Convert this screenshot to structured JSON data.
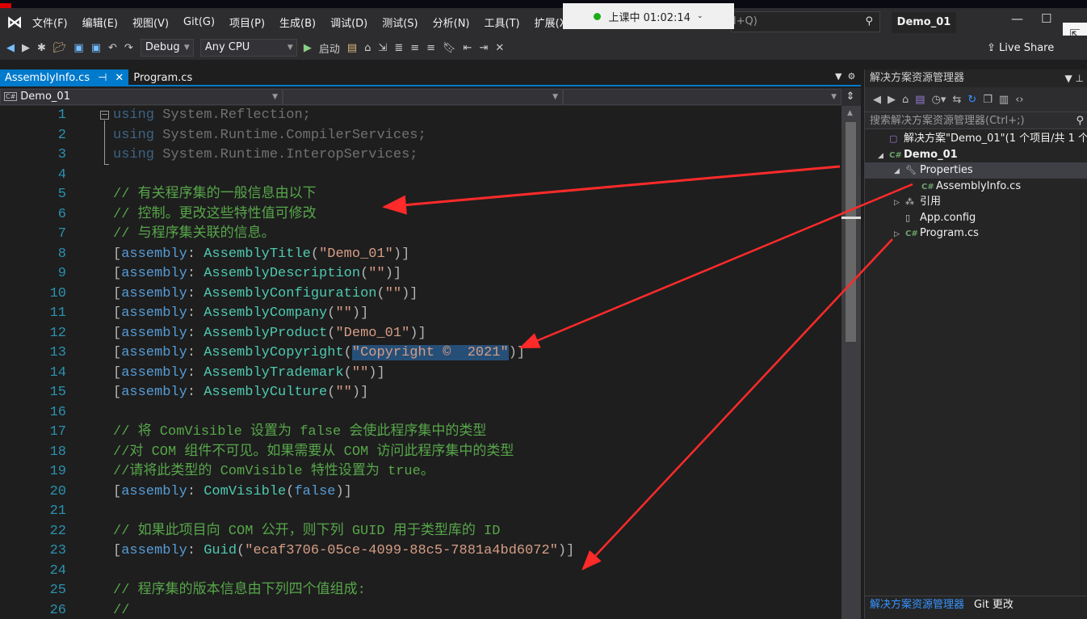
{
  "menu": {
    "items": [
      "文件(F)",
      "编辑(E)",
      "视图(V)",
      "Git(G)",
      "项目(P)",
      "生成(B)",
      "调试(D)",
      "测试(S)",
      "分析(N)",
      "工具(T)",
      "扩展(X)"
    ]
  },
  "recording": {
    "label": "上课中 01:02:14",
    "status_color": "#1aad19"
  },
  "search": {
    "placeholder": "l+Q)"
  },
  "title": "Demo_01",
  "toolbar": {
    "config": "Debug",
    "platform": "Any CPU",
    "start": "启动",
    "live_share": "Live Share"
  },
  "tabs": [
    {
      "label": "AssemblyInfo.cs",
      "active": true
    },
    {
      "label": "Program.cs",
      "active": false
    }
  ],
  "navbar": {
    "project": "Demo_01"
  },
  "code": {
    "lines": [
      [
        [
          "k d",
          "using"
        ],
        [
          "p d",
          " System.Reflection;"
        ]
      ],
      [
        [
          "k d",
          "using"
        ],
        [
          "p d",
          " System.Runtime.CompilerServices;"
        ]
      ],
      [
        [
          "k d",
          "using"
        ],
        [
          "p d",
          " System.Runtime.InteropServices;"
        ]
      ],
      [],
      [
        [
          "c",
          "// 有关程序集的一般信息由以下"
        ]
      ],
      [
        [
          "c",
          "// 控制。更改这些特性值可修改"
        ]
      ],
      [
        [
          "c",
          "// 与程序集关联的信息。"
        ]
      ],
      [
        [
          "p",
          "["
        ],
        [
          "k",
          "assembly"
        ],
        [
          "p",
          ": "
        ],
        [
          "t",
          "AssemblyTitle"
        ],
        [
          "p",
          "("
        ],
        [
          "s",
          "\"Demo_01\""
        ],
        [
          "p",
          ")]"
        ]
      ],
      [
        [
          "p",
          "["
        ],
        [
          "k",
          "assembly"
        ],
        [
          "p",
          ": "
        ],
        [
          "t",
          "AssemblyDescription"
        ],
        [
          "p",
          "("
        ],
        [
          "s",
          "\"\""
        ],
        [
          "p",
          ")]"
        ]
      ],
      [
        [
          "p",
          "["
        ],
        [
          "k",
          "assembly"
        ],
        [
          "p",
          ": "
        ],
        [
          "t",
          "AssemblyConfiguration"
        ],
        [
          "p",
          "("
        ],
        [
          "s",
          "\"\""
        ],
        [
          "p",
          ")]"
        ]
      ],
      [
        [
          "p",
          "["
        ],
        [
          "k",
          "assembly"
        ],
        [
          "p",
          ": "
        ],
        [
          "t",
          "AssemblyCompany"
        ],
        [
          "p",
          "("
        ],
        [
          "s",
          "\"\""
        ],
        [
          "p",
          ")]"
        ]
      ],
      [
        [
          "p",
          "["
        ],
        [
          "k",
          "assembly"
        ],
        [
          "p",
          ": "
        ],
        [
          "t",
          "AssemblyProduct"
        ],
        [
          "p",
          "("
        ],
        [
          "s",
          "\"Demo_01\""
        ],
        [
          "p",
          ")]"
        ]
      ],
      [
        [
          "p",
          "["
        ],
        [
          "k",
          "assembly"
        ],
        [
          "p",
          ": "
        ],
        [
          "t",
          "AssemblyCopyright"
        ],
        [
          "p",
          "("
        ],
        [
          "s sel",
          "\"Copyright ©  2021\""
        ],
        [
          "p",
          ")]"
        ]
      ],
      [
        [
          "p",
          "["
        ],
        [
          "k",
          "assembly"
        ],
        [
          "p",
          ": "
        ],
        [
          "t",
          "AssemblyTrademark"
        ],
        [
          "p",
          "("
        ],
        [
          "s",
          "\"\""
        ],
        [
          "p",
          ")]"
        ]
      ],
      [
        [
          "p",
          "["
        ],
        [
          "k",
          "assembly"
        ],
        [
          "p",
          ": "
        ],
        [
          "t",
          "AssemblyCulture"
        ],
        [
          "p",
          "("
        ],
        [
          "s",
          "\"\""
        ],
        [
          "p",
          ")]"
        ]
      ],
      [],
      [
        [
          "c",
          "// 将 ComVisible 设置为 false 会使此程序集中的类型"
        ]
      ],
      [
        [
          "c",
          "//对 COM 组件不可见。如果需要从 COM 访问此程序集中的类型"
        ]
      ],
      [
        [
          "c",
          "//请将此类型的 ComVisible 特性设置为 true。"
        ]
      ],
      [
        [
          "p",
          "["
        ],
        [
          "k",
          "assembly"
        ],
        [
          "p",
          ": "
        ],
        [
          "t",
          "ComVisible"
        ],
        [
          "p",
          "("
        ],
        [
          "k",
          "false"
        ],
        [
          "p",
          ")]"
        ]
      ],
      [],
      [
        [
          "c",
          "// 如果此项目向 COM 公开，则下列 GUID 用于类型库的 ID"
        ]
      ],
      [
        [
          "p",
          "["
        ],
        [
          "k",
          "assembly"
        ],
        [
          "p",
          ": "
        ],
        [
          "t",
          "Guid"
        ],
        [
          "p",
          "("
        ],
        [
          "s",
          "\"ecaf3706-05ce-4099-88c5-7881a4bd6072\""
        ],
        [
          "p",
          ")]"
        ]
      ],
      [],
      [
        [
          "c",
          "// 程序集的版本信息由下列四个值组成:"
        ]
      ],
      [
        [
          "c",
          "//"
        ]
      ]
    ]
  },
  "solution_explorer": {
    "title": "解决方案资源管理器",
    "search_placeholder": "搜索解决方案资源管理器(Ctrl+;)",
    "tree": [
      {
        "label": "解决方案\"Demo_01\"(1 个项目/共 1 个)",
        "level": 0,
        "expander": "",
        "icon": "solution-icon"
      },
      {
        "label": "Demo_01",
        "level": 0,
        "expander": "◢",
        "icon": "csharp-project-icon",
        "bold": true
      },
      {
        "label": "Properties",
        "level": 1,
        "expander": "◢",
        "icon": "wrench-icon",
        "selected": true
      },
      {
        "label": "AssemblyInfo.cs",
        "level": 2,
        "expander": "",
        "icon": "csharp-file-icon"
      },
      {
        "label": "引用",
        "level": 1,
        "expander": "▷",
        "icon": "references-icon"
      },
      {
        "label": "App.config",
        "level": 1,
        "expander": "",
        "icon": "config-file-icon"
      },
      {
        "label": "Program.cs",
        "level": 1,
        "expander": "▷",
        "icon": "csharp-file-icon"
      }
    ],
    "bottom_tabs": [
      "解决方案资源管理器",
      "Git 更改"
    ]
  },
  "colors": {
    "accent": "#007acc",
    "keyword": "#569cd6",
    "type": "#4ec9b0",
    "string": "#d69d85",
    "comment": "#57a64a",
    "annotation_arrow": "#ff2a2a"
  }
}
